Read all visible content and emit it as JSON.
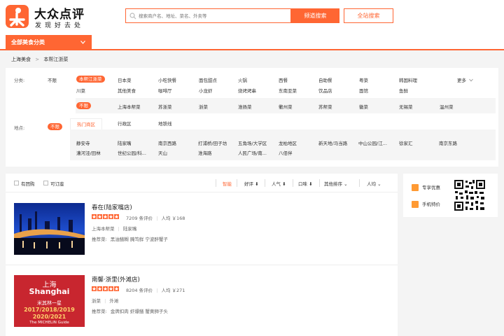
{
  "brand": {
    "title": "大众点评",
    "subtitle": "发现好去处",
    "accent": "#ff6633"
  },
  "search": {
    "placeholder": "搜索商户名、地址、菜名、外卖等",
    "channel_button": "频道搜索",
    "site_button": "全站搜索"
  },
  "category_menu": {
    "label": "全部美食分类"
  },
  "breadcrumb": [
    "上海美食",
    ">",
    "本帮江浙菜"
  ],
  "filters": {
    "category": {
      "label": "分类:",
      "any": "不限",
      "selected": "本帮江浙菜",
      "items_row1": [
        "日本菜",
        "小吃快餐",
        "面包甜点",
        "火锅",
        "西餐",
        "自助餐",
        "粤菜",
        "韩国料理"
      ],
      "more": "更多",
      "items_row2": [
        "川菜",
        "其他美食",
        "咖啡厅",
        "小龙虾",
        "烧烤烤串",
        "东南亚菜",
        "饮品店",
        "面馆",
        "鱼鲜"
      ],
      "sub_any": "不限",
      "sub_items": [
        "上海本帮菜",
        "苏浙菜",
        "浙菜",
        "淮扬菜",
        "衢州菜",
        "苏帮菜",
        "徽菜",
        "无锡菜",
        "温州菜"
      ]
    },
    "location": {
      "label": "地点:",
      "any": "不限",
      "tabs": [
        "热门商区",
        "行政区",
        "地铁线"
      ],
      "areas_row1": [
        "静安寺",
        "陆家嘴",
        "南京西路",
        "打浦桥/田子坊",
        "五角场/大学区",
        "龙柏地区",
        "新天地/马当路",
        "中山公园/江...",
        "徐家汇",
        "南京东路"
      ],
      "areas_row2": [
        "漕河泾/田林",
        "世纪公园/科...",
        "天山",
        "淮海路",
        "人民广场/南...",
        "八佰伴"
      ]
    }
  },
  "sortbar": {
    "checkbox_groupbuy": "有团购",
    "checkbox_booking": "可订座",
    "sorts": [
      "智能",
      "好评",
      "人气",
      "口味",
      "其他排序",
      "人均"
    ]
  },
  "shops": [
    {
      "name": "春在(陆家嘴店)",
      "rating": 5,
      "reviews": "7209 条评价",
      "avg_price": "人均 ￥168",
      "cuisine": "上海本帮菜",
      "area": "陆家嘴",
      "recommend_label": "推荐菜:",
      "recommend": "黑油鳝糊  腌笃鲜  宁波醉蟹子",
      "image": "night-skyline-photo"
    },
    {
      "name": "南馨·浙里(外滩店)",
      "rating": 5,
      "reviews": "8204 条评价",
      "avg_price": "人均 ￥271",
      "cuisine": "浙菜",
      "area": "外滩",
      "recommend_label": "推荐菜:",
      "recommend": "金牌扣肉  虾爆鳝  蟹黄狮子头",
      "image": "michelin-poster",
      "poster": {
        "city_cn": "上海",
        "city_en": "Shanghai",
        "award": "米其林一星",
        "years1": "2017/2018/2019",
        "years2": "2020/2021",
        "guide": "The MICHELIN Guide"
      }
    }
  ],
  "sidebar": {
    "items": [
      "专享优惠",
      "手机特价"
    ],
    "qr": "qr-code"
  }
}
